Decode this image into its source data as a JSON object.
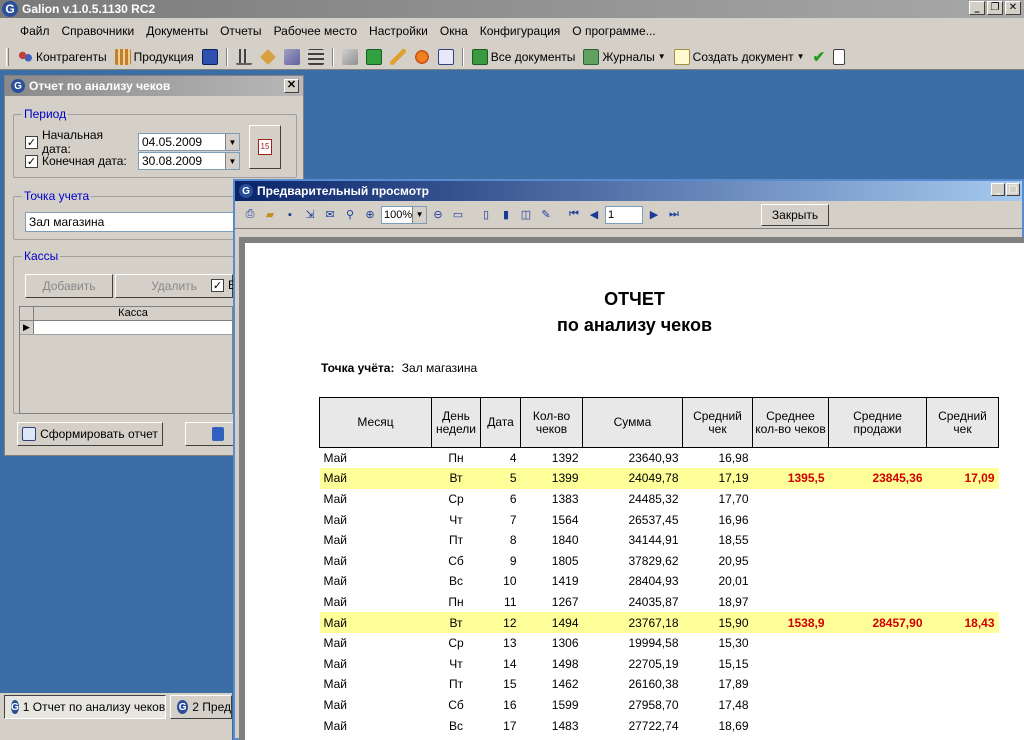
{
  "app": {
    "title": "Galion  v.1.0.5.1130 RC2",
    "window_buttons": [
      "_",
      "❐",
      "✕"
    ]
  },
  "menu": [
    "Файл",
    "Справочники",
    "Документы",
    "Отчеты",
    "Рабочее место",
    "Настройки",
    "Окна",
    "Конфигурация",
    "О программе..."
  ],
  "toolbar": {
    "counterparties": "Контрагенты",
    "products": "Продукция",
    "all_documents": "Все документы",
    "journals": "Журналы",
    "create_document": "Создать документ"
  },
  "report_dialog": {
    "title": "Отчет по анализу чеков",
    "period_label": "Период",
    "start_label": "Начальная дата:",
    "start_value": "04.05.2009",
    "end_label": "Конечная дата:",
    "end_value": "30.08.2009",
    "calendar_icon": "15",
    "point_label": "Точка учета",
    "point_value": "Зал магазина",
    "registers_label": "Кассы",
    "add_button": "Добавить",
    "delete_button": "Удалить",
    "register_column": "Касса",
    "partial_check_label": "В",
    "generate_button": "Сформировать отчет"
  },
  "preview": {
    "title": "Предварительный просмотр",
    "zoom": "100%",
    "page": "1",
    "close_button": "Закрыть",
    "report_title": "ОТЧЕТ",
    "report_subtitle": "по анализу чеков",
    "point_label": "Точка учёта:",
    "point_value": "Зал магазина",
    "columns": [
      "Месяц",
      "День недели",
      "Дата",
      "Кол-во чеков",
      "Сумма",
      "Средний чек",
      "Среднее кол-во чеков",
      "Средние продажи",
      "Средний чек"
    ],
    "rows": [
      {
        "month": "Май",
        "weekday": "Пн",
        "date": "4",
        "checks": "1392",
        "sum": "23640,93",
        "avg": "16,98",
        "avg_checks": "",
        "avg_sales": "",
        "avg_check2": "",
        "hl": false
      },
      {
        "month": "Май",
        "weekday": "Вт",
        "date": "5",
        "checks": "1399",
        "sum": "24049,78",
        "avg": "17,19",
        "avg_checks": "1395,5",
        "avg_sales": "23845,36",
        "avg_check2": "17,09",
        "hl": true
      },
      {
        "month": "Май",
        "weekday": "Ср",
        "date": "6",
        "checks": "1383",
        "sum": "24485,32",
        "avg": "17,70",
        "avg_checks": "",
        "avg_sales": "",
        "avg_check2": "",
        "hl": false
      },
      {
        "month": "Май",
        "weekday": "Чт",
        "date": "7",
        "checks": "1564",
        "sum": "26537,45",
        "avg": "16,96",
        "avg_checks": "",
        "avg_sales": "",
        "avg_check2": "",
        "hl": false
      },
      {
        "month": "Май",
        "weekday": "Пт",
        "date": "8",
        "checks": "1840",
        "sum": "34144,91",
        "avg": "18,55",
        "avg_checks": "",
        "avg_sales": "",
        "avg_check2": "",
        "hl": false
      },
      {
        "month": "Май",
        "weekday": "Сб",
        "date": "9",
        "checks": "1805",
        "sum": "37829,62",
        "avg": "20,95",
        "avg_checks": "",
        "avg_sales": "",
        "avg_check2": "",
        "hl": false
      },
      {
        "month": "Май",
        "weekday": "Вс",
        "date": "10",
        "checks": "1419",
        "sum": "28404,93",
        "avg": "20,01",
        "avg_checks": "",
        "avg_sales": "",
        "avg_check2": "",
        "hl": false
      },
      {
        "month": "Май",
        "weekday": "Пн",
        "date": "11",
        "checks": "1267",
        "sum": "24035,87",
        "avg": "18,97",
        "avg_checks": "",
        "avg_sales": "",
        "avg_check2": "",
        "hl": false
      },
      {
        "month": "Май",
        "weekday": "Вт",
        "date": "12",
        "checks": "1494",
        "sum": "23767,18",
        "avg": "15,90",
        "avg_checks": "1538,9",
        "avg_sales": "28457,90",
        "avg_check2": "18,43",
        "hl": true
      },
      {
        "month": "Май",
        "weekday": "Ср",
        "date": "13",
        "checks": "1306",
        "sum": "19994,58",
        "avg": "15,30",
        "avg_checks": "",
        "avg_sales": "",
        "avg_check2": "",
        "hl": false
      },
      {
        "month": "Май",
        "weekday": "Чт",
        "date": "14",
        "checks": "1498",
        "sum": "22705,19",
        "avg": "15,15",
        "avg_checks": "",
        "avg_sales": "",
        "avg_check2": "",
        "hl": false
      },
      {
        "month": "Май",
        "weekday": "Пт",
        "date": "15",
        "checks": "1462",
        "sum": "26160,38",
        "avg": "17,89",
        "avg_checks": "",
        "avg_sales": "",
        "avg_check2": "",
        "hl": false
      },
      {
        "month": "Май",
        "weekday": "Сб",
        "date": "16",
        "checks": "1599",
        "sum": "27958,70",
        "avg": "17,48",
        "avg_checks": "",
        "avg_sales": "",
        "avg_check2": "",
        "hl": false
      },
      {
        "month": "Май",
        "weekday": "Вс",
        "date": "17",
        "checks": "1483",
        "sum": "27722,74",
        "avg": "18,69",
        "avg_checks": "",
        "avg_sales": "",
        "avg_check2": "",
        "hl": false
      }
    ]
  },
  "taskbar": {
    "task1": "1 Отчет по анализу чеков",
    "task2": "2 Пред"
  }
}
